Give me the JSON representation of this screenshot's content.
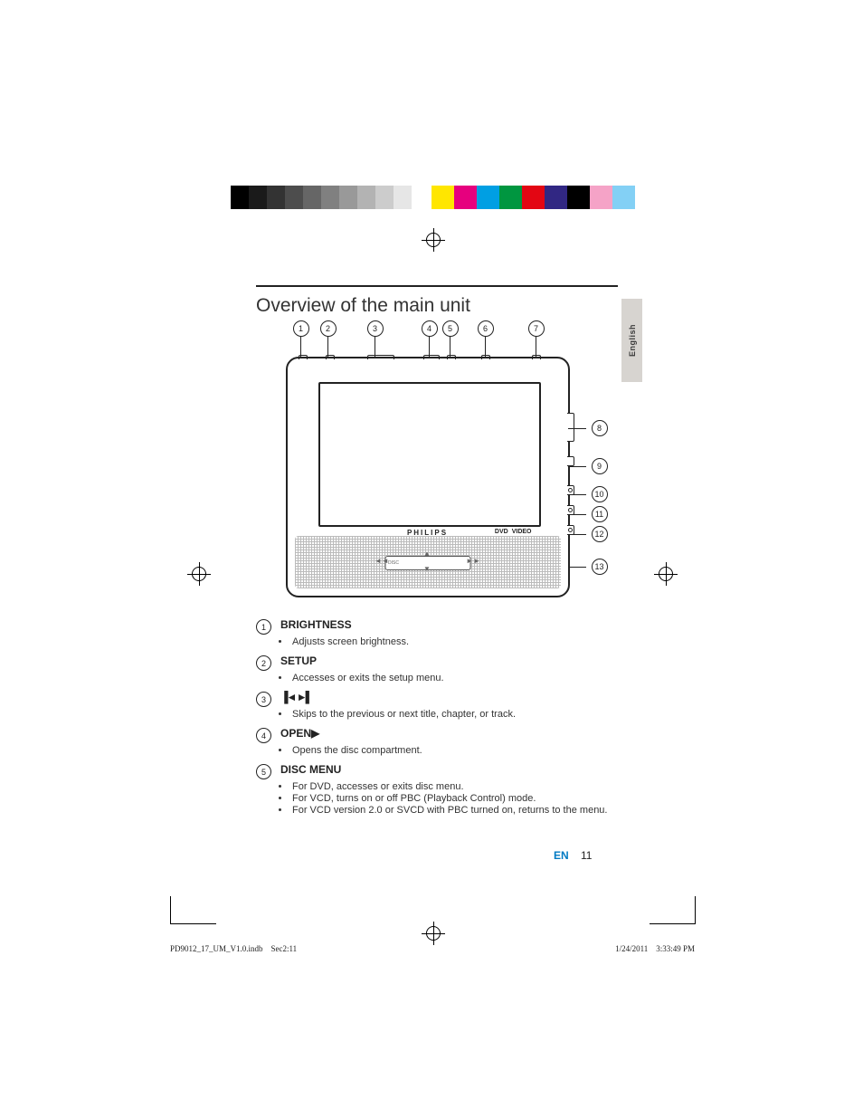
{
  "header": {
    "title": "Overview of the main unit"
  },
  "language_tab": "English",
  "diagram": {
    "top_callouts": [
      "1",
      "2",
      "3",
      "4",
      "5",
      "6",
      "7"
    ],
    "right_callouts": [
      "8",
      "9",
      "10",
      "11",
      "12",
      "13"
    ],
    "brand": "PHILIPS",
    "logo1": "DVD",
    "logo2": "VIDEO",
    "slot_label": "DISC"
  },
  "items": [
    {
      "num": "1",
      "title": "BRIGHTNESS",
      "bullets": [
        "Adjusts screen brightness."
      ]
    },
    {
      "num": "2",
      "title": "SETUP",
      "bullets": [
        "Accesses or exits the setup menu."
      ]
    },
    {
      "num": "3",
      "title_icon": "skip",
      "bullets": [
        "Skips to the previous or next title, chapter, or track."
      ]
    },
    {
      "num": "4",
      "title": "OPEN",
      "title_suffix_icon": "play",
      "bullets": [
        "Opens the disc compartment."
      ]
    },
    {
      "num": "5",
      "title": "DISC MENU",
      "bullets": [
        "For DVD, accesses or exits disc menu.",
        "For VCD, turns on or off PBC (Playback Control) mode.",
        "For VCD version 2.0 or SVCD with PBC turned on, returns to the menu."
      ]
    }
  ],
  "page": {
    "lang": "EN",
    "number": "11"
  },
  "footer": {
    "left_file": "PD9012_17_UM_V1.0.indb",
    "left_sec": "Sec2:11",
    "date": "1/24/2011",
    "time": "3:33:49 PM"
  }
}
